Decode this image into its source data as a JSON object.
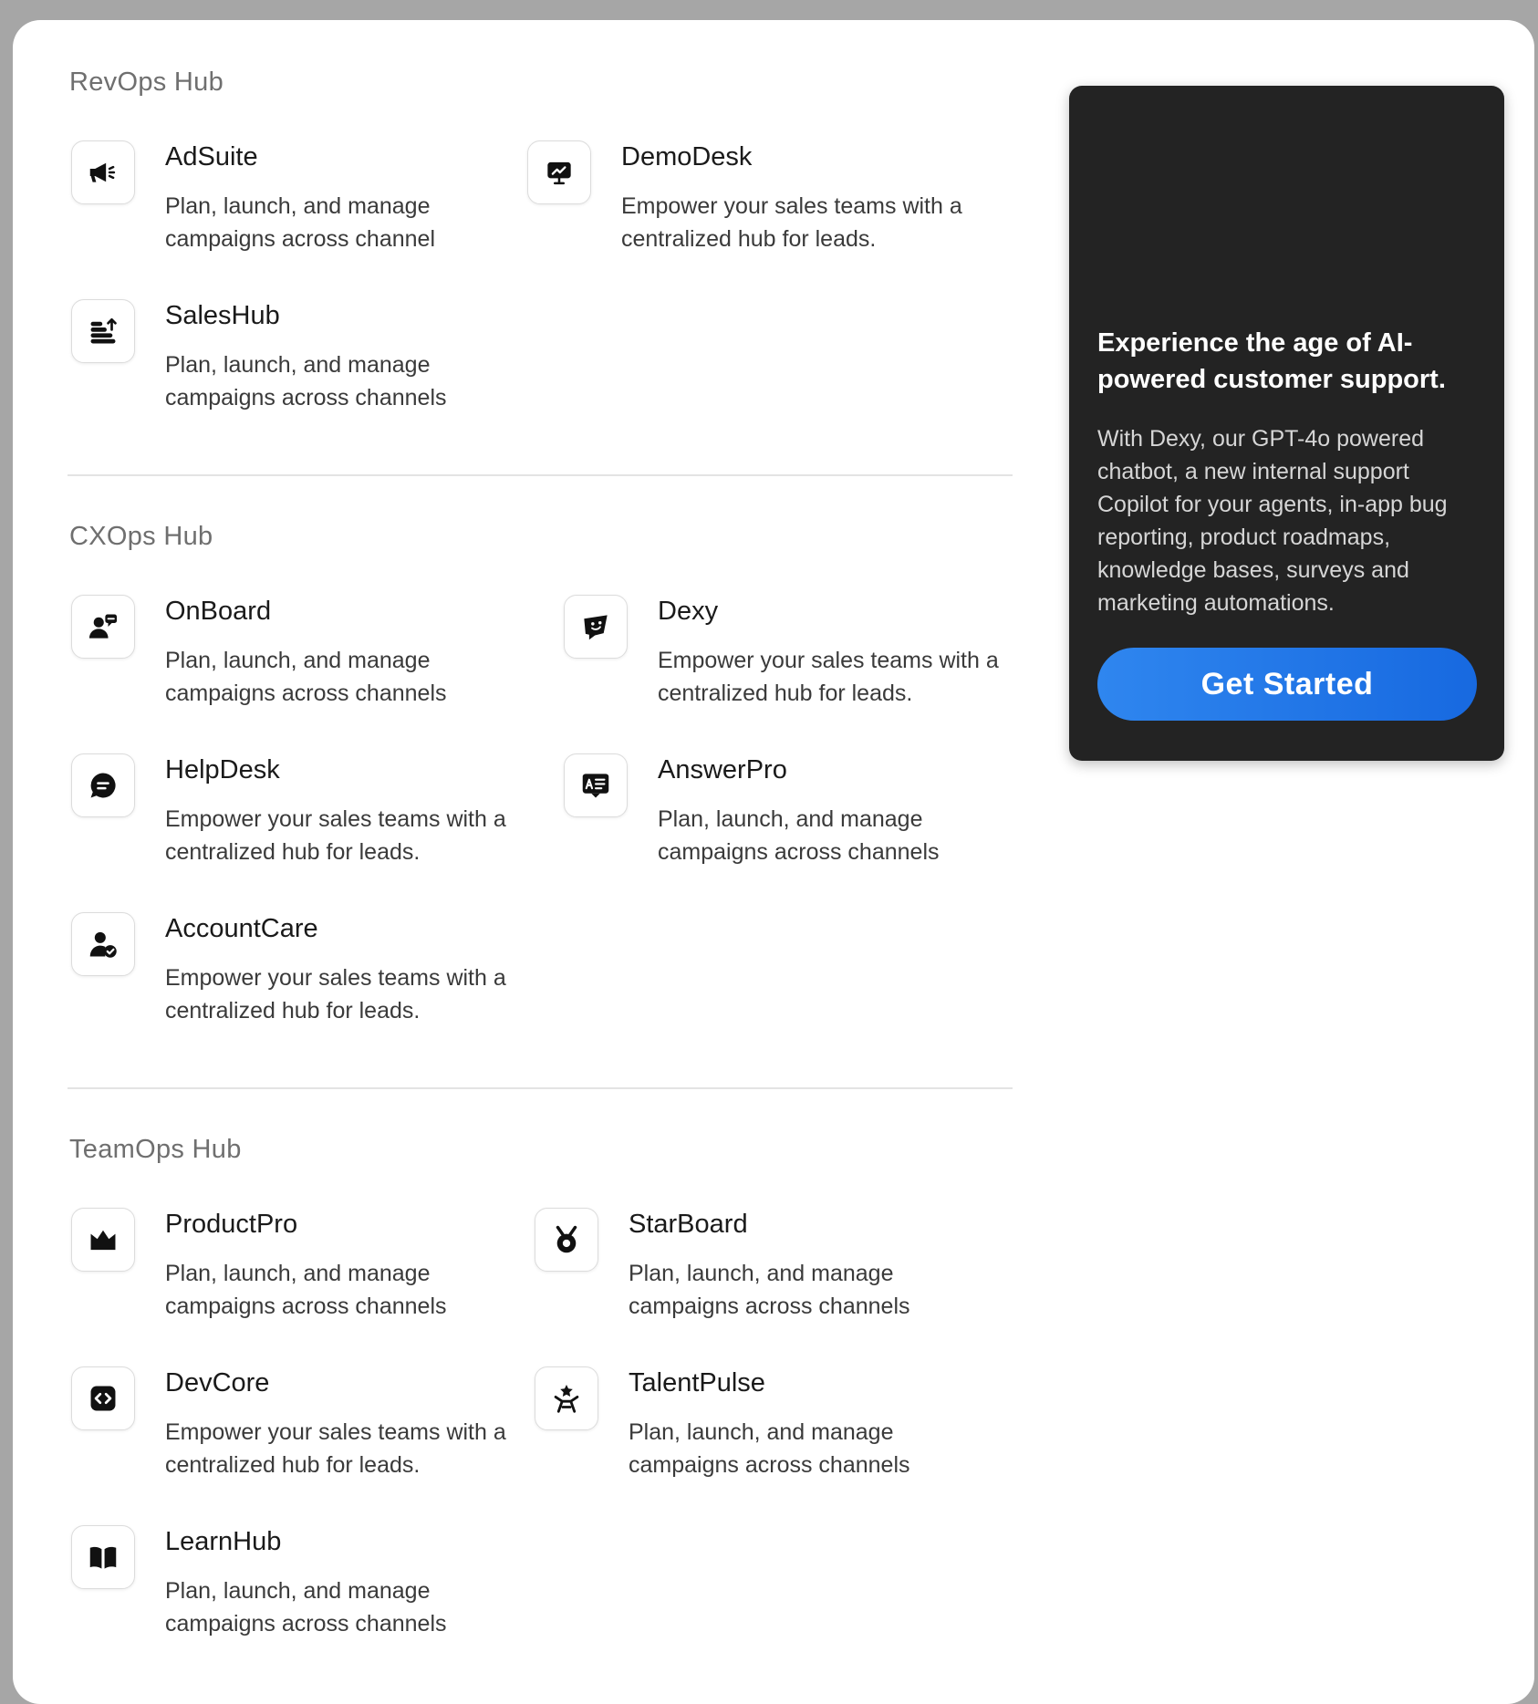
{
  "sections": [
    {
      "label": "RevOps Hub",
      "items": [
        {
          "title": "AdSuite",
          "description": "Plan, launch, and manage campaigns across channel",
          "icon": "megaphone-icon"
        },
        {
          "title": "DemoDesk",
          "description": "Empower your sales teams with a centralized hub for leads.",
          "icon": "presentation-chart-icon"
        },
        {
          "title": "SalesHub",
          "description": "Plan, launch, and manage campaigns across channels",
          "icon": "stacked-coins-icon"
        }
      ]
    },
    {
      "label": "CXOps Hub",
      "items": [
        {
          "title": "OnBoard",
          "description": "Plan, launch, and manage campaigns across channels",
          "icon": "user-chat-icon"
        },
        {
          "title": "Dexy",
          "description": "Empower your sales teams with a centralized hub for leads.",
          "icon": "happy-chat-icon"
        },
        {
          "title": "HelpDesk",
          "description": "Empower your sales teams with a centralized hub for leads.",
          "icon": "message-bubble-icon"
        },
        {
          "title": "AnswerPro",
          "description": "Plan, launch, and manage campaigns across channels",
          "icon": "answer-card-icon"
        },
        {
          "title": "AccountCare",
          "description": "Empower your sales teams with a centralized hub for leads.",
          "icon": "user-check-icon"
        }
      ]
    },
    {
      "label": "TeamOps Hub",
      "items": [
        {
          "title": "ProductPro",
          "description": "Plan, launch, and manage campaigns across channels",
          "icon": "crown-icon"
        },
        {
          "title": "StarBoard",
          "description": "Plan, launch, and manage campaigns across channels",
          "icon": "medal-icon"
        },
        {
          "title": "DevCore",
          "description": "Empower your sales teams with a centralized hub for leads.",
          "icon": "code-icon"
        },
        {
          "title": "TalentPulse",
          "description": "Plan, launch, and manage campaigns across channels",
          "icon": "star-person-icon"
        },
        {
          "title": "LearnHub",
          "description": "Plan, launch, and manage campaigns across channels",
          "icon": "open-book-icon"
        }
      ]
    }
  ],
  "promo": {
    "heading": "Experience the age of AI-powered customer support.",
    "body": "With Dexy, our GPT-4o powered chatbot, a new internal support Copilot for your agents, in-app bug reporting, product roadmaps, knowledge bases, surveys and marketing automations.",
    "button_label": "Get Started"
  },
  "colors": {
    "backdrop": "#a6a6a6",
    "panel": "#ffffff",
    "promo_background": "#232323",
    "button_accent": "#1f77e8"
  }
}
